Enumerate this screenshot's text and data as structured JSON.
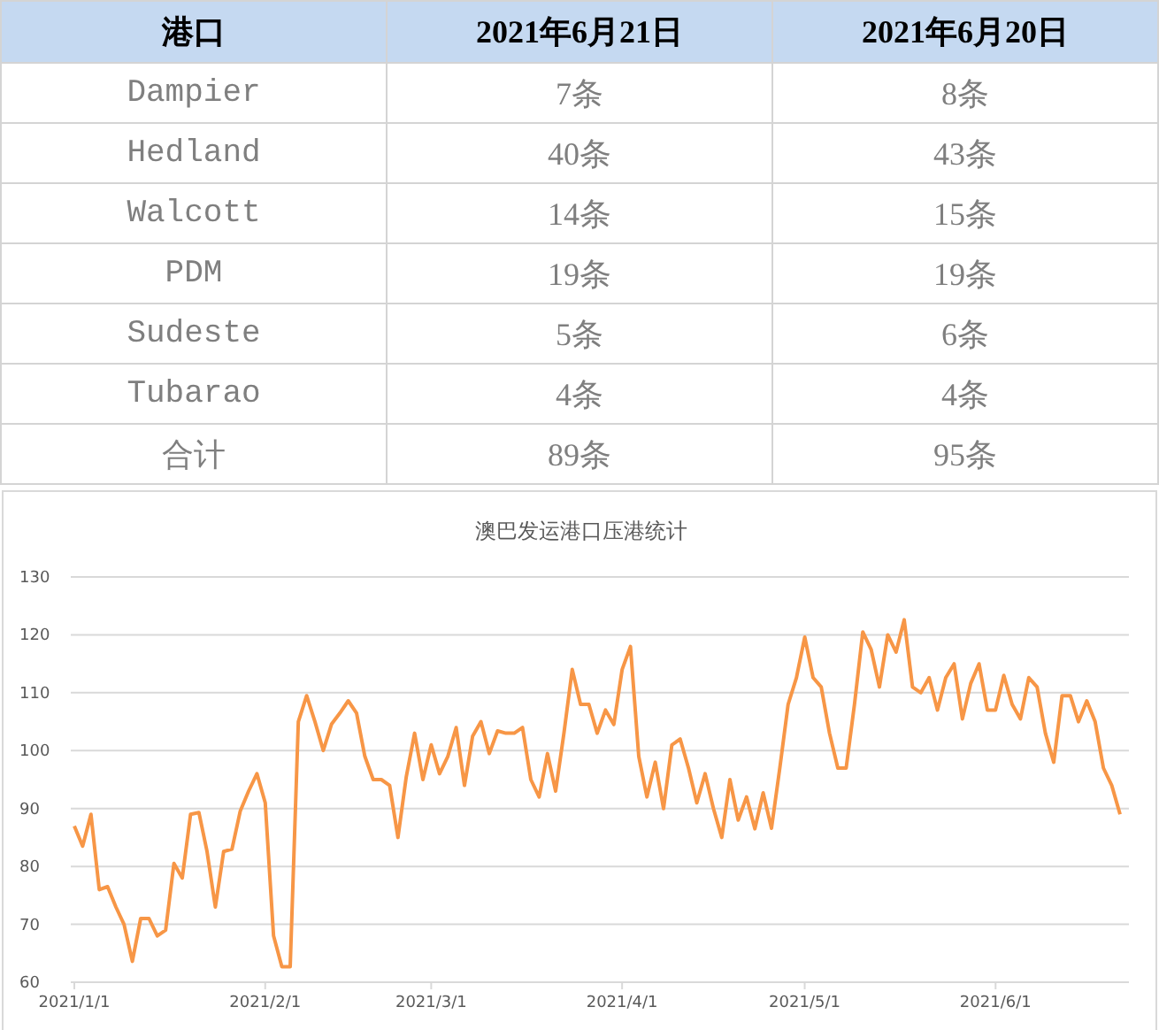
{
  "table": {
    "columns": [
      "港口",
      "2021年6月21日",
      "2021年6月20日"
    ],
    "rows": [
      [
        "Dampier",
        "7条",
        "8条"
      ],
      [
        "Hedland",
        "40条",
        "43条"
      ],
      [
        "Walcott",
        "14条",
        "15条"
      ],
      [
        "PDM",
        "19条",
        "19条"
      ],
      [
        "Sudeste",
        "5条",
        "6条"
      ],
      [
        "Tubarao",
        "4条",
        "4条"
      ],
      [
        "合计",
        "89条",
        "95条"
      ]
    ]
  },
  "chart": {
    "chart_data": {
      "type": "line",
      "title": "澳巴发运港口压港统计",
      "grid": true,
      "ylim": [
        60,
        130
      ],
      "yticks": [
        60,
        70,
        80,
        90,
        100,
        110,
        120,
        130
      ],
      "categories": [
        "2021/1/1",
        null,
        null,
        null,
        null,
        null,
        null,
        null,
        null,
        null,
        null,
        null,
        null,
        null,
        null,
        null,
        null,
        null,
        null,
        null,
        null,
        null,
        null,
        "2021/2/1",
        null,
        null,
        null,
        null,
        null,
        null,
        null,
        null,
        null,
        null,
        null,
        null,
        null,
        null,
        null,
        null,
        null,
        null,
        null,
        "2021/3/1",
        null,
        null,
        null,
        null,
        null,
        null,
        null,
        null,
        null,
        null,
        null,
        null,
        null,
        null,
        null,
        null,
        null,
        null,
        null,
        null,
        null,
        null,
        "2021/4/1",
        null,
        null,
        null,
        null,
        null,
        null,
        null,
        null,
        null,
        null,
        null,
        null,
        null,
        null,
        null,
        null,
        null,
        null,
        null,
        null,
        null,
        "2021/5/1",
        null,
        null,
        null,
        null,
        null,
        null,
        null,
        null,
        null,
        null,
        null,
        null,
        null,
        null,
        null,
        null,
        null,
        null,
        null,
        null,
        null,
        null,
        "2021/6/1",
        null,
        null,
        null,
        null,
        null,
        null,
        null,
        null,
        null,
        null,
        null,
        null,
        null,
        null,
        null
      ],
      "series": [
        {
          "color": "#f79646",
          "values": [
            87,
            83.5,
            89,
            76,
            76.5,
            73,
            70,
            63.6,
            71,
            71,
            68,
            69,
            80.5,
            78,
            89,
            89.3,
            82.6,
            73,
            82.6,
            83,
            89.6,
            93,
            96,
            91,
            68,
            62.7,
            62.7,
            105,
            109.5,
            105,
            100,
            104.6,
            106.5,
            108.6,
            106.5,
            99,
            95,
            95,
            94,
            85,
            95.5,
            103,
            95,
            101,
            96,
            99,
            104,
            94,
            102.5,
            105,
            99.5,
            103.4,
            103,
            103,
            104,
            95,
            92,
            99.5,
            93,
            103,
            114,
            108,
            108,
            103,
            107,
            104.5,
            114,
            118,
            99,
            92,
            98,
            90,
            101,
            102,
            97,
            91,
            96,
            90,
            85,
            95,
            88,
            92,
            86.5,
            92.7,
            86.6,
            97,
            108,
            112.6,
            119.6,
            112.6,
            111,
            103,
            97,
            97,
            108,
            120.5,
            117.5,
            111,
            120,
            117,
            122.6,
            111,
            110,
            112.6,
            107,
            112.6,
            115,
            105.5,
            111.6,
            115,
            107,
            107,
            113,
            108,
            105.5,
            112.6,
            111,
            103,
            98,
            109.5,
            109.5,
            105,
            108.6,
            105,
            97,
            94,
            89
          ]
        }
      ]
    }
  }
}
